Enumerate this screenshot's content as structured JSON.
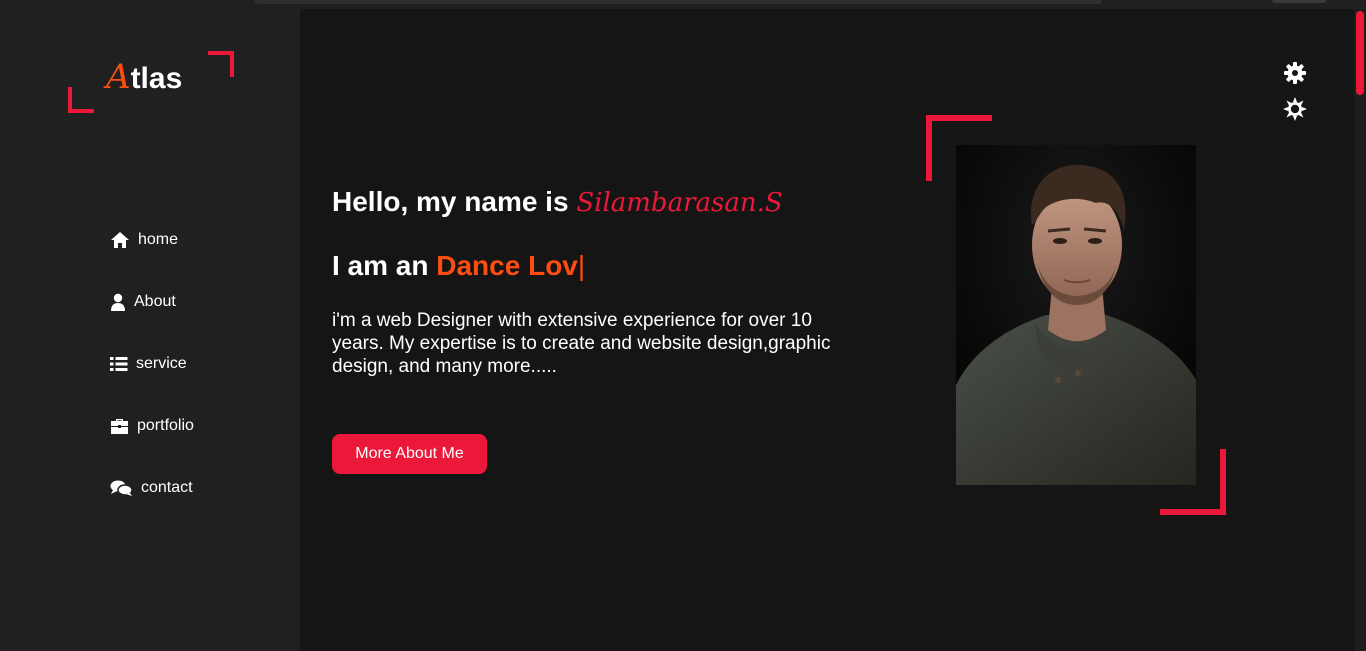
{
  "brand": {
    "first_letter": "A",
    "rest": "tlas"
  },
  "nav": {
    "items": [
      {
        "label": "home",
        "icon": "home-icon"
      },
      {
        "label": "About",
        "icon": "user-icon"
      },
      {
        "label": "service",
        "icon": "list-icon"
      },
      {
        "label": "portfolio",
        "icon": "briefcase-icon"
      },
      {
        "label": "contact",
        "icon": "comments-icon"
      }
    ]
  },
  "hero": {
    "greeting": "Hello, my name is",
    "name": "Silambarasan.S",
    "role_prefix": "I am an",
    "role_typed": "Dance Lov",
    "cursor": "|",
    "description": "i'm a web Designer with extensive experience for over 10 years. My expertise is to create and website design,graphic design, and many more.....",
    "button": "More About Me"
  },
  "colors": {
    "accent": "#ec1839",
    "highlight": "#ff4d12",
    "background": "#151515",
    "sidebar": "#202020"
  },
  "icons": {
    "settings": "gear-icon",
    "theme": "sun-icon"
  }
}
